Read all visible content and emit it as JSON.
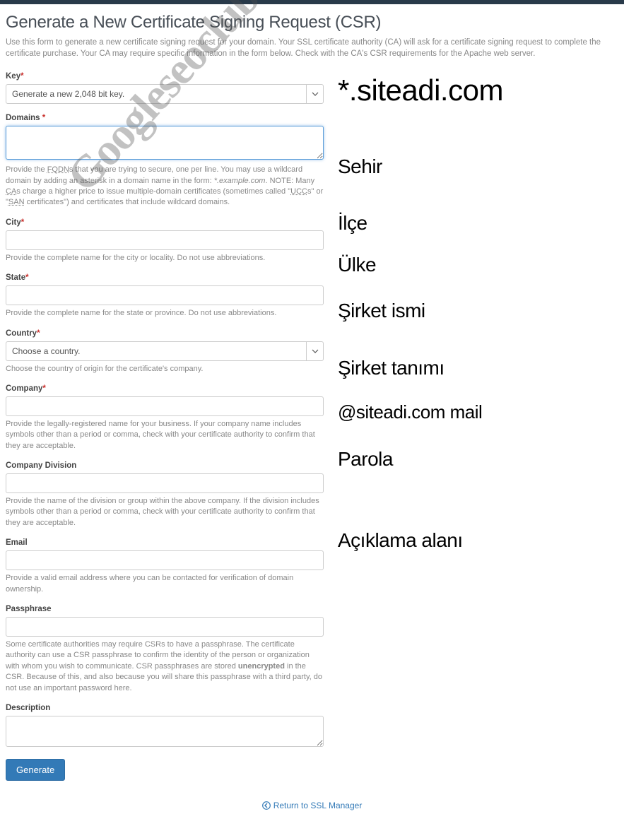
{
  "page": {
    "title": "Generate a New Certificate Signing Request (CSR)",
    "intro": "Use this form to generate a new certificate signing request for your domain. Your SSL certificate authority (CA) will ask for a certificate signing request to complete the certificate purchase. Your CA may require specific information in the form below. Check with the CA's CSR requirements for the Apache web server."
  },
  "form": {
    "key": {
      "label": "Key",
      "value": "Generate a new 2,048 bit key."
    },
    "domains": {
      "label": "Domains",
      "help_pre": "Provide the ",
      "help_fqdn": "FQDN",
      "help_mid1": "s that you are trying to secure, one per line. You may use a wildcard domain by adding an asterisk in a domain name in the form: ",
      "help_example": "*.example.com",
      "help_mid2": ". NOTE: Many ",
      "help_ca": "CA",
      "help_mid3": "s charge a higher price to issue multiple-domain certificates (sometimes called \"",
      "help_ucc": "UCC",
      "help_mid4": "s\" or \"",
      "help_san": "SAN",
      "help_mid5": " certificates\") and certificates that include wildcard domains."
    },
    "city": {
      "label": "City",
      "help": "Provide the complete name for the city or locality. Do not use abbreviations."
    },
    "state": {
      "label": "State",
      "help": "Provide the complete name for the state or province. Do not use abbreviations."
    },
    "country": {
      "label": "Country",
      "value": "Choose a country.",
      "help": "Choose the country of origin for the certificate's company."
    },
    "company": {
      "label": "Company",
      "help": "Provide the legally-registered name for your business. If your company name includes symbols other than a period or comma, check with your certificate authority to confirm that they are acceptable."
    },
    "division": {
      "label": "Company Division",
      "help": "Provide the name of the division or group within the above company. If the division includes symbols other than a period or comma, check with your certificate authority to confirm that they are acceptable."
    },
    "email": {
      "label": "Email",
      "help": "Provide a valid email address where you can be contacted for verification of domain ownership."
    },
    "passphrase": {
      "label": "Passphrase",
      "help_pre": "Some certificate authorities may require CSRs to have a passphrase. The certificate authority can use a CSR passphrase to confirm the identity of the person or organization with whom you wish to communicate. CSR passphrases are stored ",
      "help_bold": "unencrypted",
      "help_post": " in the CSR. Because of this, and also because you will share this passphrase with a third party, do not use an important password here."
    },
    "description": {
      "label": "Description"
    },
    "submit": "Generate"
  },
  "footer": {
    "return_link": "Return to SSL Manager"
  },
  "annotations": {
    "domains": "*.siteadi.com",
    "city": "Sehir",
    "state": "İlçe",
    "country": "Ülke",
    "company": "Şirket ismi",
    "division": "Şirket tanımı",
    "email": "@siteadi.com mail",
    "passphrase": "Parola",
    "description": "Açıklama alanı"
  },
  "watermark": "Googleseoclub.com"
}
